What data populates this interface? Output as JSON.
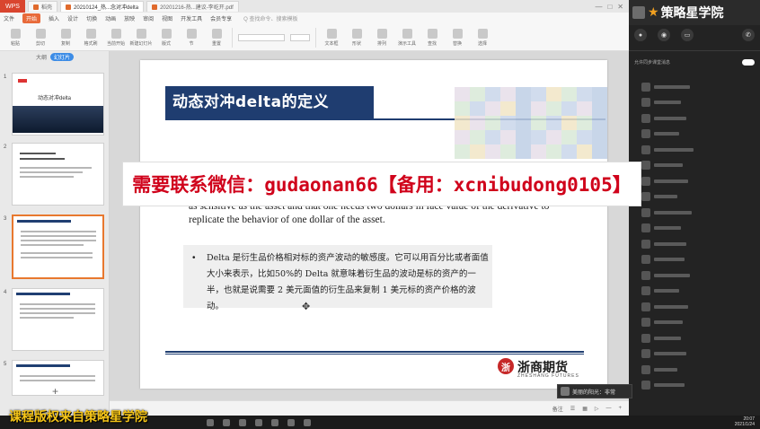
{
  "titlebar": {
    "app_badge": "WPS",
    "tabs": [
      {
        "label": "稻壳"
      },
      {
        "label": "20210124_热...念对冲delta"
      },
      {
        "label": "20201216-热...建议-李屹开.pdf"
      }
    ]
  },
  "menubar": {
    "items": [
      "文件",
      "开始",
      "插入",
      "设计",
      "切换",
      "动画",
      "放映",
      "审阅",
      "视图",
      "开发工具",
      "会员专享"
    ],
    "search": "Q 查找命令、搜索模板"
  },
  "ribbon": {
    "buttons": [
      "粘贴",
      "剪切",
      "复制",
      "格式刷",
      "当前开始",
      "新建幻灯片",
      "版式",
      "节",
      "重置",
      "文本框",
      "形状",
      "排列",
      "演示工具",
      "查找",
      "替换",
      "选择"
    ]
  },
  "thumbs": {
    "tab_outline": "大纲",
    "tab_slides": "幻灯片",
    "slide_numbers": [
      "1",
      "2",
      "3",
      "4",
      "5"
    ],
    "slide1_title": "动态对冲delta",
    "add_label": "+"
  },
  "slide": {
    "title": "动态对冲delta的定义",
    "en_text": "as sensitive as the asset and that one needs two dollars in face value of the derivative to replicate the behavior of one dollar of the asset.",
    "bullet": "Delta 是衍生品价格相对标的资产波动的敏感度。它可以用百分比或者面值大小来表示，比如50%的 Delta 就意味着衍生品的波动是标的资产的一半，也就是说需要 2 美元面值的衍生品来复制 1 美元标的资产价格的波动。",
    "cursor": "✥",
    "logo_mark": "浙",
    "logo_cn": "浙商期货",
    "logo_en": "ZHESHANG FUTURES"
  },
  "statusbar": {
    "items": [
      "备注",
      "☰",
      "▦",
      "▷",
      "—",
      "+"
    ]
  },
  "right_panel": {
    "brand": "策略星学院",
    "star": "★",
    "toggle_label": "允许同步课堂消息"
  },
  "chat_popup": {
    "name": "美丽的阳光：非常"
  },
  "taskbar": {
    "time": "20:07",
    "date": "2021/1/24"
  },
  "overlay": {
    "ad_text": "需要联系微信：gudaonan66【备用：xcnibudong0105】",
    "watermark": "课程版权来自策略星学院"
  },
  "colors": {
    "title_bg": "#1f3d70",
    "wps_red": "#d9452f",
    "ad_red": "#d0021b",
    "watermark_yellow": "#f5c518"
  }
}
